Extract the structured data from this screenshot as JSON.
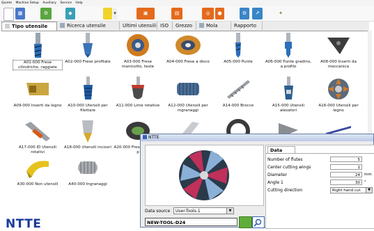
{
  "menubar": {
    "items": [
      "Quinto",
      "Machine Setup",
      "Auxiliary",
      "Service",
      "Help"
    ]
  },
  "tabs": [
    {
      "label": "Tipo utensile",
      "active": true
    },
    {
      "label": "Ricerca utensile",
      "active": false
    },
    {
      "label": "Ultimi utensili",
      "active": false
    },
    {
      "label": "ISO",
      "active": false
    },
    {
      "label": "Grezzo",
      "active": false
    },
    {
      "label": "Mola",
      "active": false
    },
    {
      "label": "Rapporto",
      "active": false
    }
  ],
  "tools": [
    {
      "label": "A01-000 Frese cilindriche, raggiate",
      "icon": "end-mill-icon"
    },
    {
      "label": "A02-000 Frese profilate",
      "icon": "profile-cutter-icon"
    },
    {
      "label": "A03-000 Frese manicotto, teste",
      "icon": "shell-mill-icon"
    },
    {
      "label": "A04-000 Frese a disco",
      "icon": "disc-cutter-icon"
    },
    {
      "label": "A05-000 Punte",
      "icon": "drill-icon"
    },
    {
      "label": "A06-000 Punte gradino, a profilo",
      "icon": "step-drill-icon"
    },
    {
      "label": "A08-000 Inserti da meccanica",
      "icon": "insert-icon"
    },
    {
      "label": "A09-000 Inserti da legno",
      "icon": "wood-insert-icon"
    },
    {
      "label": "A10-000 Utensili per filettare",
      "icon": "thread-tool-icon"
    },
    {
      "label": "A11-000 Lime rotative",
      "icon": "rotary-file-icon"
    },
    {
      "label": "A12-000 Utensili per ingranaggi",
      "icon": "gear-hob-icon"
    },
    {
      "label": "A14-000 Brocce",
      "icon": "broach-icon"
    },
    {
      "label": "A15-000 Utensili alesatori",
      "icon": "reamer-icon"
    },
    {
      "label": "A16-000 Utensili per legno",
      "icon": "wood-cutter-icon"
    },
    {
      "label": "A17-000 ID Utensili rotativi",
      "icon": "rotary-tool-icon"
    },
    {
      "label": "A18-000 Utensili incisori",
      "icon": "engraver-icon"
    },
    {
      "label": "A20-000 Frese cilindrica, p",
      "icon": "cylinder-cutter-icon"
    },
    {
      "label": "",
      "icon": "grinding-wheel-icon"
    },
    {
      "label": "",
      "icon": "ring-tool-icon"
    },
    {
      "label": "",
      "icon": "cone-tool-icon"
    },
    {
      "label": "",
      "icon": "slim-tool-icon"
    },
    {
      "label": "A30-000 Non utensili",
      "icon": "non-tool-icon"
    },
    {
      "label": "A40-000 Ingranaggi",
      "icon": "gear-icon"
    }
  ],
  "logo": "NTTE",
  "dialog": {
    "title": "NTTE",
    "data_source_label": "Data source",
    "data_source_value": "User-Tools-1",
    "tool_name": "NEW-TOOL-D24",
    "props_tab": "Data",
    "rows": [
      {
        "label": "Number of flutes",
        "value": "5",
        "unit": ""
      },
      {
        "label": "Center cutting wings",
        "value": "1",
        "unit": ""
      },
      {
        "label": "Diameter",
        "value": "24",
        "unit": "mm"
      },
      {
        "label": "Angle 1",
        "value": "30",
        "unit": "°"
      },
      {
        "label": "Cutting direction",
        "value": "Right hand cut",
        "unit": ""
      }
    ]
  }
}
